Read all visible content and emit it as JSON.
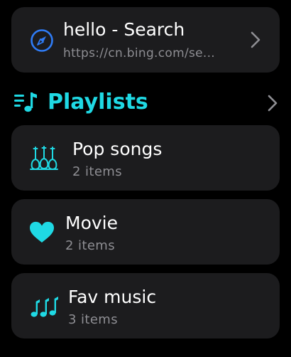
{
  "history": {
    "title": "hello - Search",
    "url": "https://cn.bing.com/se..."
  },
  "playlists": {
    "section_title": "Playlists",
    "items": [
      {
        "name": "Pop songs",
        "count": "2 items",
        "icon": "guitars-icon"
      },
      {
        "name": "Movie",
        "count": "2 items",
        "icon": "heart-icon"
      },
      {
        "name": "Fav music",
        "count": "3 items",
        "icon": "music-notes-icon"
      }
    ]
  },
  "colors": {
    "accent": "#1fd9e4",
    "link_icon": "#2f7cf6",
    "card_bg": "#1c1c1e",
    "secondary_text": "#8e8e93",
    "chevron": "#8e8e93"
  }
}
